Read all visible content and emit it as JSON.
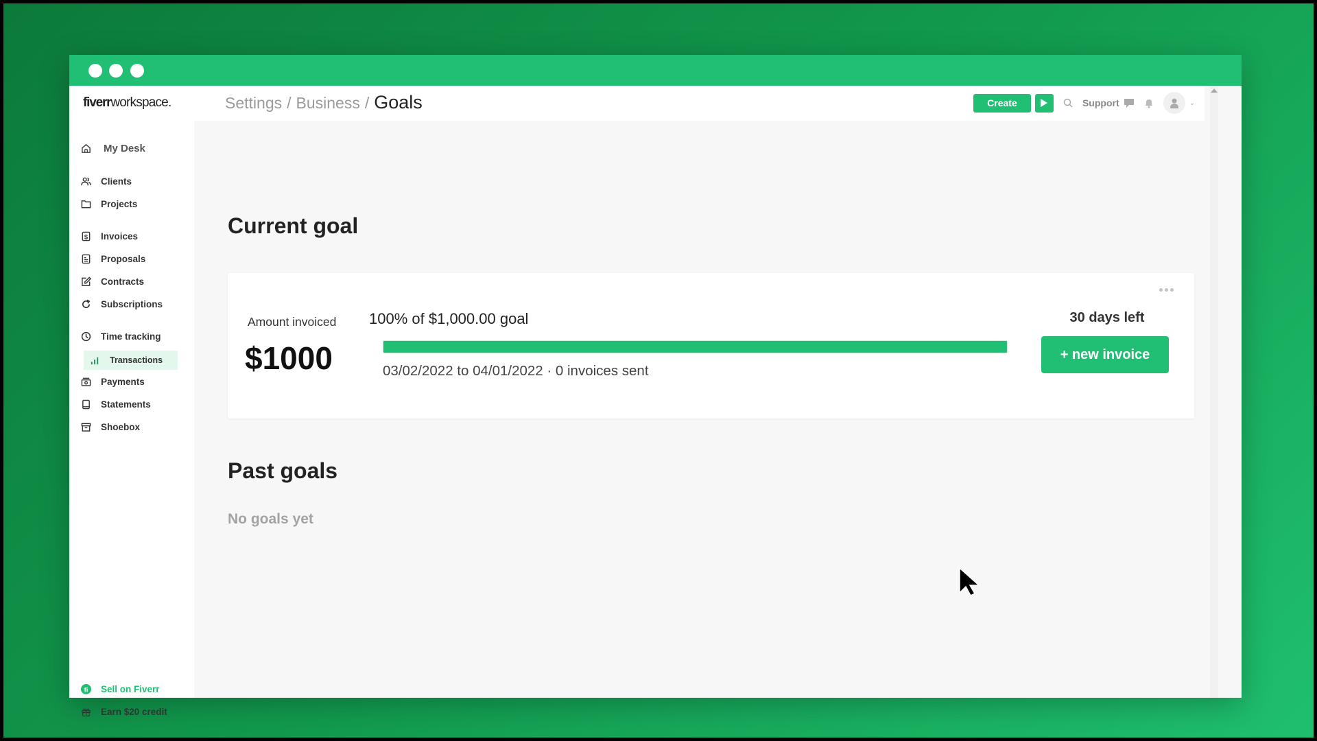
{
  "app": {
    "logo_brand": "fiverr",
    "logo_product": "workspace."
  },
  "header": {
    "breadcrumb": [
      {
        "label": "Settings"
      },
      {
        "label": "Business"
      },
      {
        "label": "Goals"
      }
    ],
    "separator": "/",
    "create_label": "Create",
    "play_icon": "play-icon",
    "search_icon": "search-icon",
    "support_label": "Support",
    "support_icon": "chat-bubble-icon",
    "notifications_icon": "bell-icon",
    "avatar_icon": "user-icon"
  },
  "sidebar": {
    "items": [
      {
        "label": "My Desk",
        "icon": "home-icon"
      },
      {
        "label": "Clients",
        "icon": "users-icon"
      },
      {
        "label": "Projects",
        "icon": "folder-icon"
      },
      {
        "label": "Invoices",
        "icon": "invoice-dollar-icon"
      },
      {
        "label": "Proposals",
        "icon": "document-icon"
      },
      {
        "label": "Contracts",
        "icon": "edit-icon"
      },
      {
        "label": "Subscriptions",
        "icon": "refresh-icon"
      },
      {
        "label": "Time tracking",
        "icon": "clock-icon"
      },
      {
        "label": "Transactions",
        "icon": "bar-chart-icon",
        "active": true
      },
      {
        "label": "Payments",
        "icon": "cash-icon"
      },
      {
        "label": "Statements",
        "icon": "tablet-icon"
      },
      {
        "label": "Shoebox",
        "icon": "archive-box-icon"
      }
    ],
    "footer": [
      {
        "label": "Sell on Fiverr",
        "icon": "fiverr-logo-icon"
      },
      {
        "label": "Earn $20 credit",
        "icon": "gift-icon"
      }
    ]
  },
  "main": {
    "current_goal_heading": "Current goal",
    "card": {
      "amount_label": "Amount invoiced",
      "amount_value": "$1000",
      "percent_text": "100%",
      "goal_text": "of $1,000.00 goal",
      "progress_percent": 100,
      "date_range": "03/02/2022 to 04/01/2022 · 0 invoices sent",
      "days_left": "30 days left",
      "new_invoice_label": "+ new invoice",
      "more_icon": "more-horizontal-icon"
    },
    "past_goals_heading": "Past goals",
    "empty_text": "No goals yet"
  },
  "colors": {
    "brand_green": "#20bf73",
    "active_nav_bg": "#e3f7ec"
  }
}
